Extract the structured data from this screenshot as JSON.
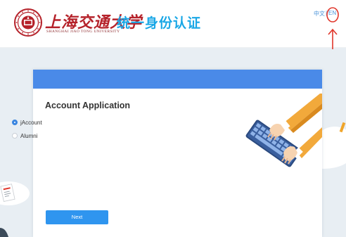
{
  "header": {
    "university_name_cn": "上海交通大学",
    "university_name_en": "SHANGHAI JIAO TONG UNIVERSITY",
    "system_title": "统一身份认证",
    "language": {
      "chinese": "中文",
      "separator": "|",
      "english": "EN"
    }
  },
  "card": {
    "title": "Account Application",
    "options": [
      {
        "label": "jAccount",
        "selected": true
      },
      {
        "label": "Alumni",
        "selected": false
      }
    ],
    "next_button": "Next"
  },
  "colors": {
    "title_blue": "#1aa7e6",
    "card_bar": "#4a8ae8",
    "button": "#2f95ef",
    "university_red": "#b5222a",
    "annotation_red": "#e0362b"
  },
  "icons": {
    "emblem": "sjtu-emblem-icon",
    "illustration": "keyboard-typing-illustration",
    "annotation_circle": "red-circle-annotation",
    "annotation_arrow": "red-up-arrow-annotation"
  }
}
